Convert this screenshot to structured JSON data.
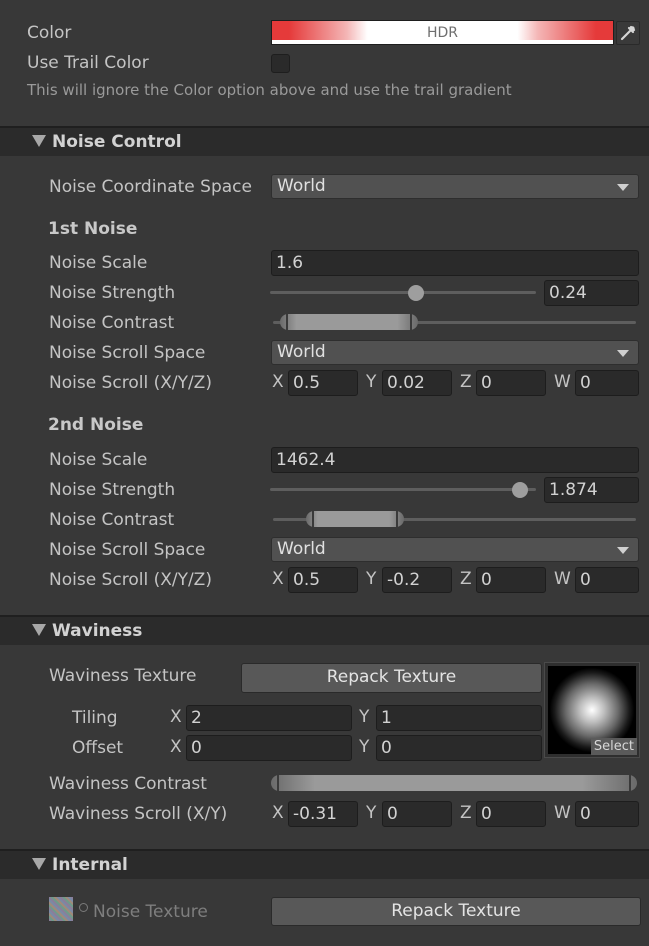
{
  "top": {
    "color_label": "Color",
    "color_value_text": "HDR",
    "color_accent": "#e53a3a",
    "use_trail_color_label": "Use Trail Color",
    "use_trail_color_checked": false,
    "hint": "This will ignore the Color option above and use the trail gradient"
  },
  "noise_control": {
    "header": "Noise Control",
    "coord_space_label": "Noise Coordinate Space",
    "coord_space_value": "World",
    "first": {
      "title": "1st Noise",
      "scale_label": "Noise Scale",
      "scale_value": "1.6",
      "strength_label": "Noise Strength",
      "strength_value": "0.24",
      "strength_fraction": 0.55,
      "contrast_label": "Noise Contrast",
      "contrast_min_fraction": 0.02,
      "contrast_max_fraction": 0.4,
      "scroll_space_label": "Noise Scroll Space",
      "scroll_space_value": "World",
      "scroll_label": "Noise Scroll (X/Y/Z)",
      "scroll": {
        "x_label": "X",
        "x": "0.5",
        "y_label": "Y",
        "y": "0.02",
        "z_label": "Z",
        "z": "0",
        "w_label": "W",
        "w": "0"
      }
    },
    "second": {
      "title": "2nd Noise",
      "scale_label": "Noise Scale",
      "scale_value": "1462.4",
      "strength_label": "Noise Strength",
      "strength_value": "1.874",
      "strength_fraction": 0.94,
      "contrast_label": "Noise Contrast",
      "contrast_min_fraction": 0.09,
      "contrast_max_fraction": 0.36,
      "scroll_space_label": "Noise Scroll Space",
      "scroll_space_value": "World",
      "scroll_label": "Noise Scroll (X/Y/Z)",
      "scroll": {
        "x_label": "X",
        "x": "0.5",
        "y_label": "Y",
        "y": "-0.2",
        "z_label": "Z",
        "z": "0",
        "w_label": "W",
        "w": "0"
      }
    }
  },
  "waviness": {
    "header": "Waviness",
    "texture_label": "Waviness Texture",
    "repack_button": "Repack Texture",
    "select_label": "Select",
    "tiling_label": "Tiling",
    "tiling": {
      "x_label": "X",
      "x": "2",
      "y_label": "Y",
      "y": "1"
    },
    "offset_label": "Offset",
    "offset": {
      "x_label": "X",
      "x": "0",
      "y_label": "Y",
      "y": "0"
    },
    "contrast_label": "Waviness Contrast",
    "contrast_min_fraction": 0.0,
    "contrast_max_fraction": 1.0,
    "scroll_label": "Waviness Scroll (X/Y)",
    "scroll": {
      "x_label": "X",
      "x": "-0.31",
      "y_label": "Y",
      "y": "0",
      "z_label": "Z",
      "z": "0",
      "w_label": "W",
      "w": "0"
    }
  },
  "internal": {
    "header": "Internal",
    "noise_texture_label": "Noise Texture",
    "repack_button": "Repack Texture"
  }
}
